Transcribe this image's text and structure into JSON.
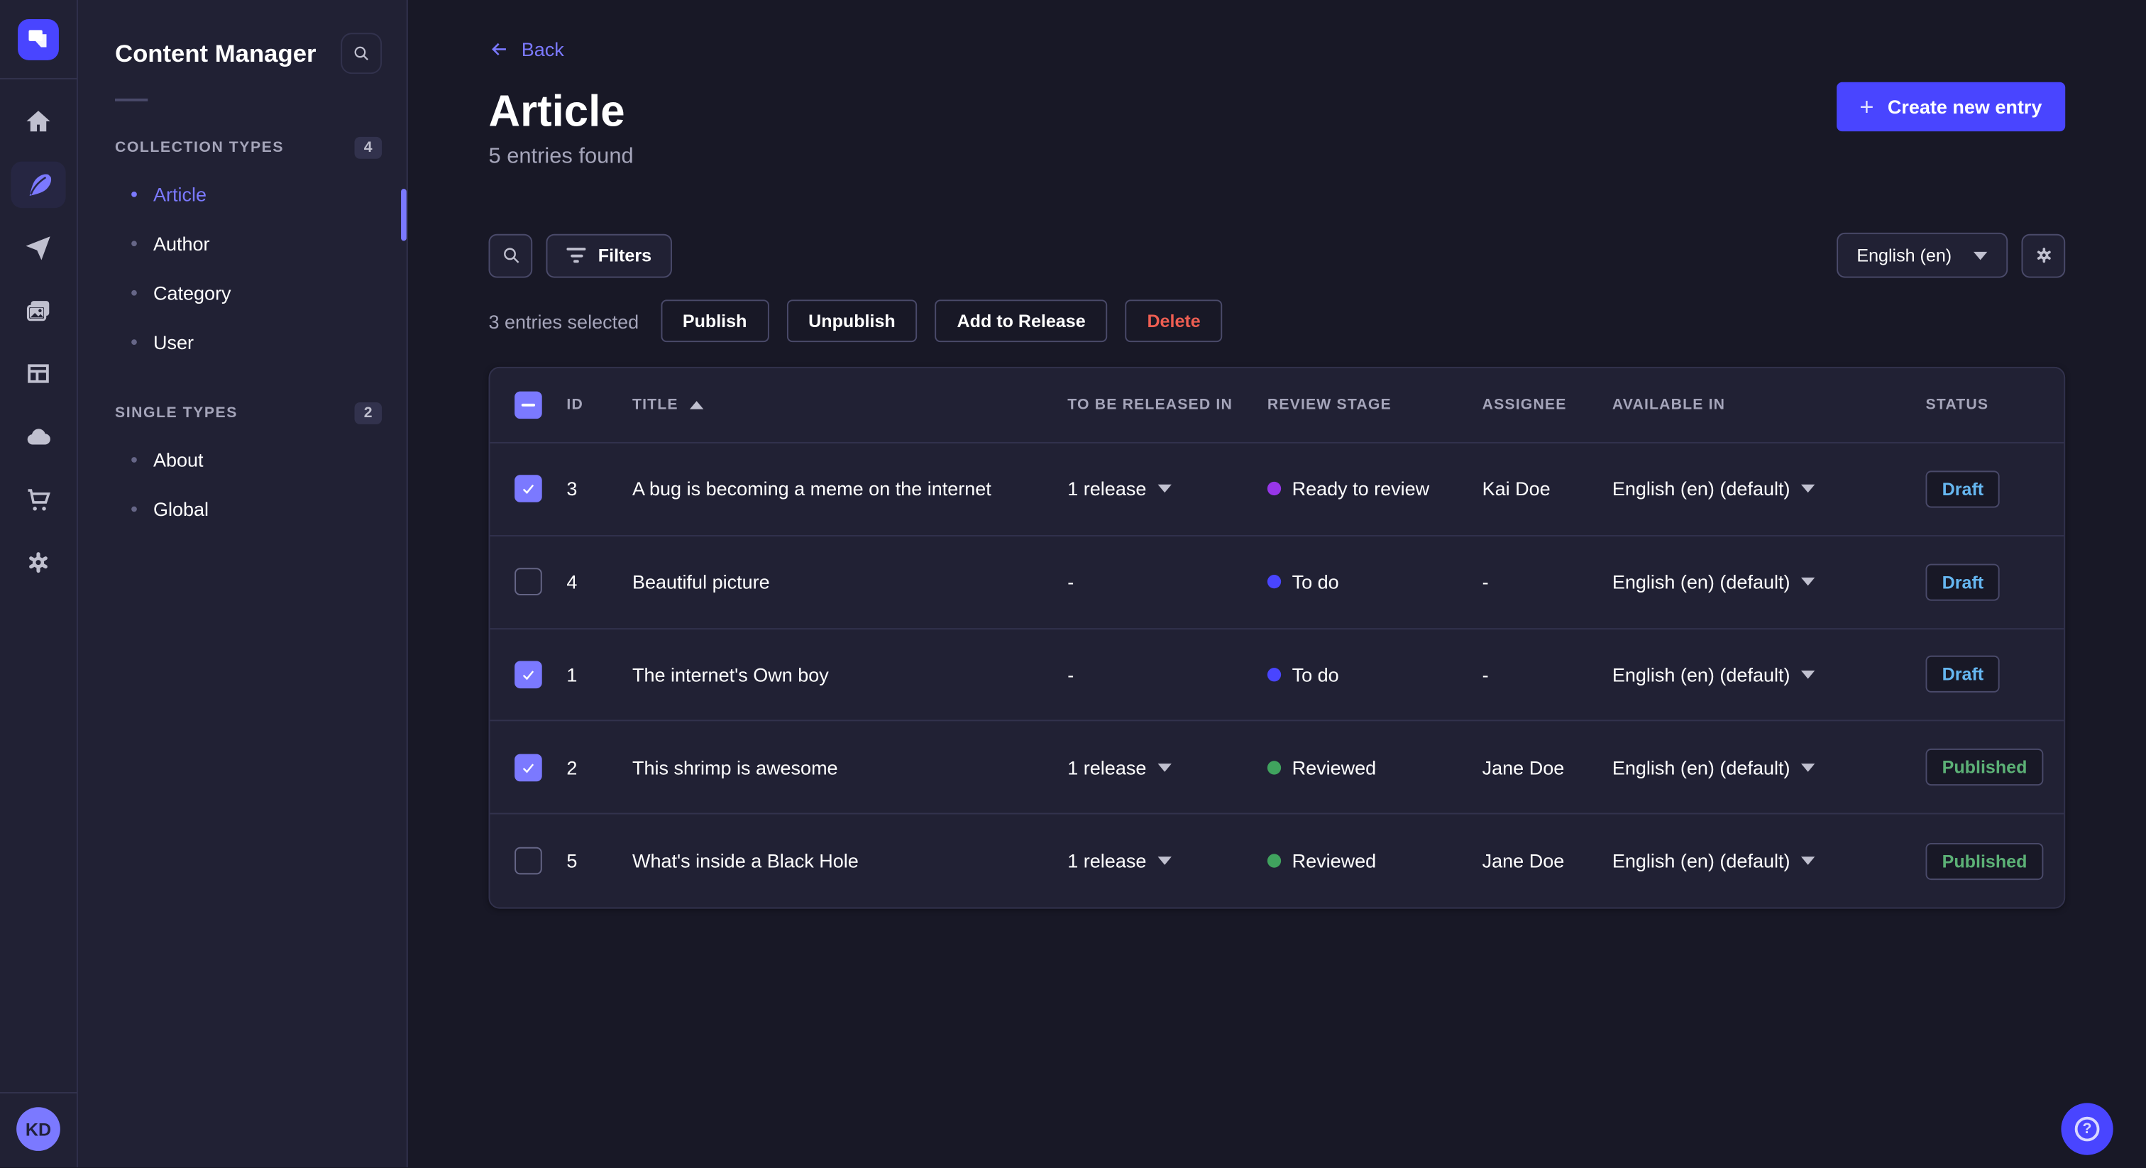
{
  "app": {
    "name": "Content Manager"
  },
  "rail": {
    "icons": [
      "home-icon",
      "feather-content-icon",
      "paper-plane-icon",
      "media-images-icon",
      "layout-builder-icon",
      "cloud-icon",
      "marketplace-cart-icon",
      "settings-gear-icon"
    ],
    "active_icon": "feather-content-icon",
    "avatar_initials": "KD"
  },
  "sidebar": {
    "title": "Content Manager",
    "sections": [
      {
        "label": "COLLECTION TYPES",
        "count": "4",
        "items": [
          {
            "label": "Article",
            "active": true
          },
          {
            "label": "Author",
            "active": false
          },
          {
            "label": "Category",
            "active": false
          },
          {
            "label": "User",
            "active": false
          }
        ]
      },
      {
        "label": "SINGLE TYPES",
        "count": "2",
        "items": [
          {
            "label": "About",
            "active": false
          },
          {
            "label": "Global",
            "active": false
          }
        ]
      }
    ]
  },
  "header": {
    "back_label": "Back",
    "title": "Article",
    "subtitle": "5 entries found",
    "create_button_label": "Create new entry"
  },
  "toolbar": {
    "filters_label": "Filters",
    "locale_value": "English (en)"
  },
  "selection": {
    "count_text": "3 entries selected",
    "actions": [
      {
        "label": "Publish",
        "variant": "default"
      },
      {
        "label": "Unpublish",
        "variant": "default"
      },
      {
        "label": "Add to Release",
        "variant": "default"
      },
      {
        "label": "Delete",
        "variant": "danger"
      }
    ]
  },
  "table": {
    "columns": [
      "ID",
      "TITLE",
      "TO BE RELEASED IN",
      "REVIEW STAGE",
      "ASSIGNEE",
      "AVAILABLE IN",
      "STATUS"
    ],
    "sorted_column": "TITLE",
    "sort_direction": "asc",
    "header_checkbox_state": "indeterminate",
    "rows": [
      {
        "checked": true,
        "id": "3",
        "title": "A bug is becoming a meme on the internet",
        "release": "1 release",
        "release_caret": true,
        "stage": "Ready to review",
        "stage_color": "#9736e8",
        "assignee": "Kai Doe",
        "locale": "English (en) (default)",
        "status": "Draft"
      },
      {
        "checked": false,
        "id": "4",
        "title": "Beautiful picture",
        "release": "-",
        "release_caret": false,
        "stage": "To do",
        "stage_color": "#4945ff",
        "assignee": "-",
        "locale": "English (en) (default)",
        "status": "Draft"
      },
      {
        "checked": true,
        "id": "1",
        "title": "The internet's Own boy",
        "release": "-",
        "release_caret": false,
        "stage": "To do",
        "stage_color": "#4945ff",
        "assignee": "-",
        "locale": "English (en) (default)",
        "status": "Draft"
      },
      {
        "checked": true,
        "id": "2",
        "title": "This shrimp is awesome",
        "release": "1 release",
        "release_caret": true,
        "stage": "Reviewed",
        "stage_color": "#40a35e",
        "assignee": "Jane Doe",
        "locale": "English (en) (default)",
        "status": "Published"
      },
      {
        "checked": false,
        "id": "5",
        "title": "What's inside a Black Hole",
        "release": "1 release",
        "release_caret": true,
        "stage": "Reviewed",
        "stage_color": "#40a35e",
        "assignee": "Jane Doe",
        "locale": "English (en) (default)",
        "status": "Published"
      }
    ]
  },
  "colors": {
    "accent": "#4945ff",
    "accent_light": "#7b79ff",
    "status_draft": "#66b7f1",
    "status_published": "#5cb176",
    "danger": "#ee5e52",
    "page_background": "#181826",
    "panel_background": "#212134"
  }
}
